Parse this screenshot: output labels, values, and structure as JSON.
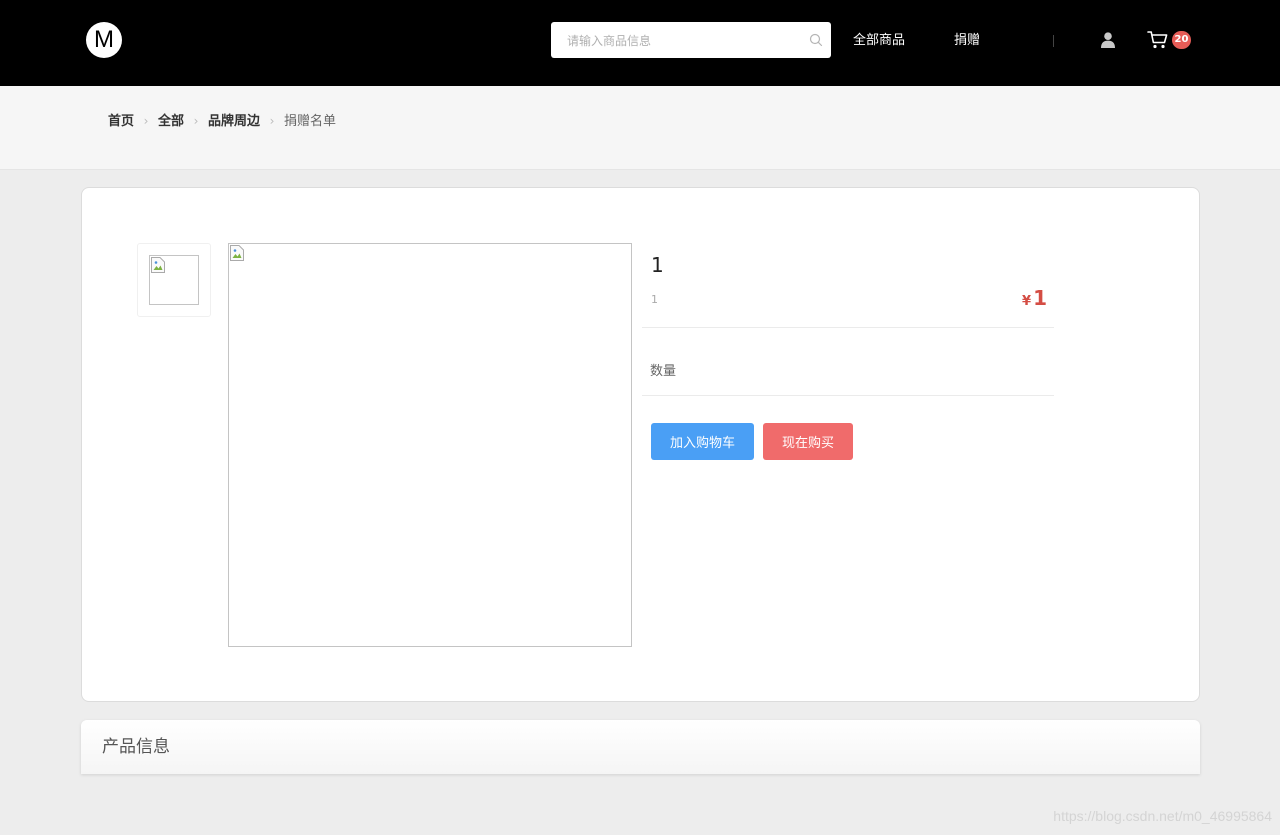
{
  "header": {
    "logo_text": "M",
    "search": {
      "placeholder": "请输入商品信息",
      "value": ""
    },
    "nav": {
      "all_products": "全部商品",
      "donate": "捐赠"
    },
    "cart_count": "20"
  },
  "breadcrumb": {
    "items": [
      {
        "label": "首页"
      },
      {
        "label": "全部"
      },
      {
        "label": "品牌周边"
      },
      {
        "label": "捐赠名单"
      }
    ]
  },
  "product": {
    "title": "1",
    "subtitle": "1",
    "price_currency": "¥",
    "price": "1",
    "quantity_label": "数量",
    "add_to_cart_label": "加入购物车",
    "buy_now_label": "现在购买"
  },
  "info_section": {
    "title": "产品信息"
  },
  "watermark": "https://blog.csdn.net/m0_46995864",
  "colors": {
    "header_bg": "#000000",
    "price": "#d44d44",
    "add_to_cart": "#4a9ff5",
    "buy_now": "#f06b6b",
    "cart_badge": "#e65c57"
  }
}
